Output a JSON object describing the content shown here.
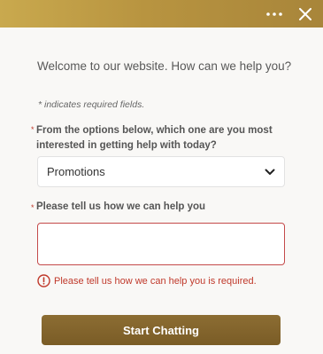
{
  "header": {
    "more_icon": "more-horizontal-icon",
    "close_icon": "close-icon",
    "gradient_start": "#c9a94e",
    "gradient_end": "#a8853a"
  },
  "form": {
    "welcome_text": "Welcome to our website. How can we help you?",
    "required_note": "* indicates required fields.",
    "required_marker": "*",
    "question_label": "From the options below, which one are you most interested in getting help with today?",
    "select_value": "Promotions",
    "help_label": "Please tell us how we can help you",
    "help_value": "",
    "error_text": "Please tell us how we can help you is required.",
    "submit_label": "Start Chatting"
  },
  "colors": {
    "error": "#c0392b",
    "button": "#7a5c26",
    "background": "#f9f8f6"
  }
}
